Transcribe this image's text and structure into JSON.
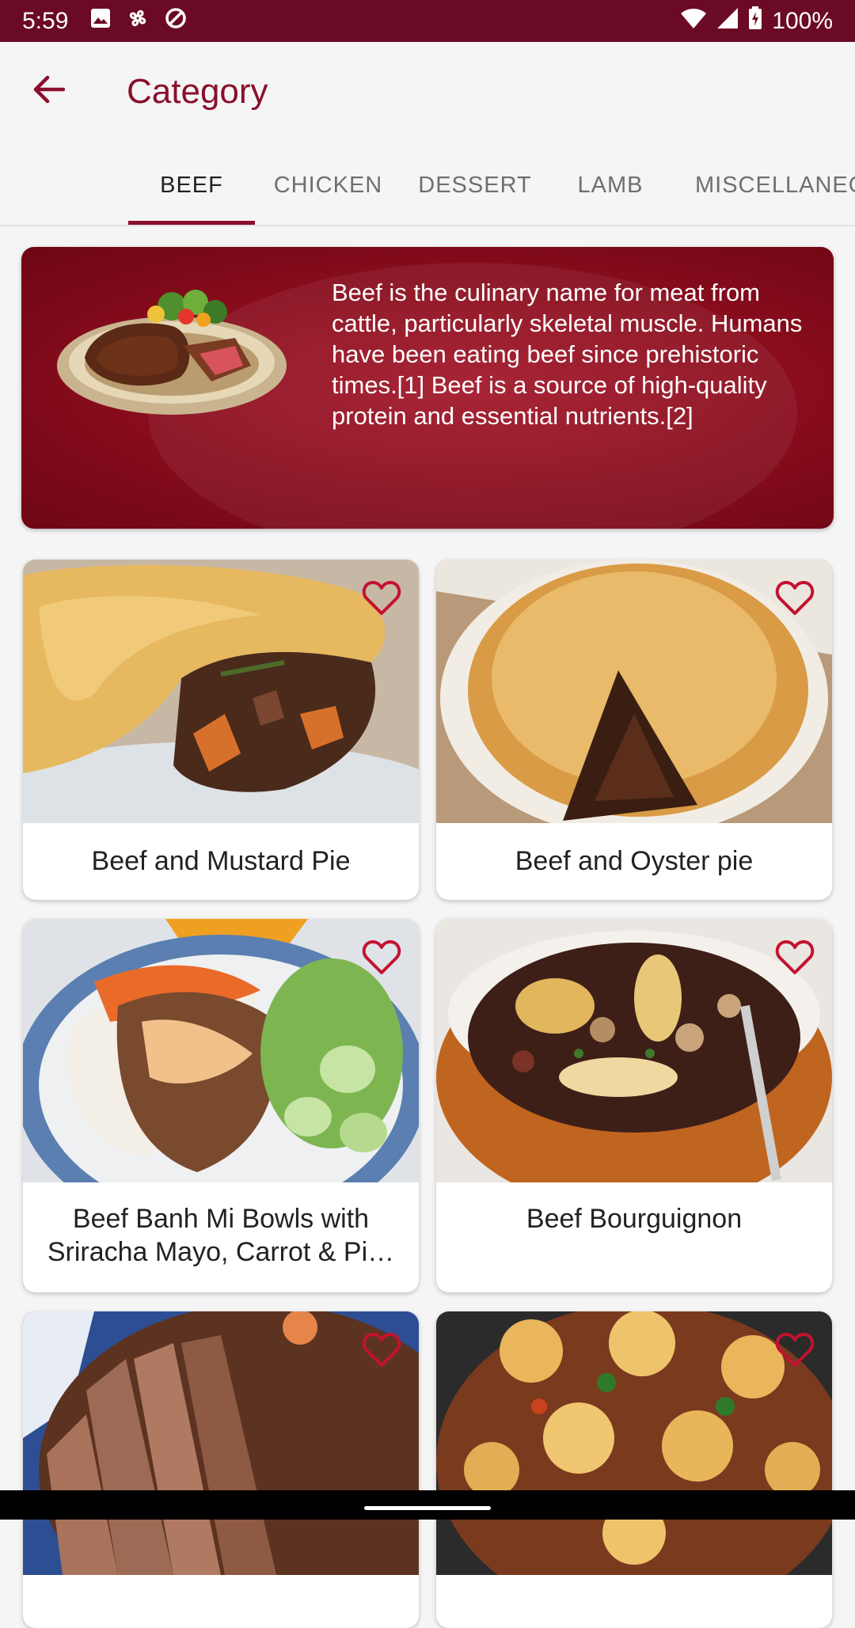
{
  "status_bar": {
    "time": "5:59",
    "battery": "100%",
    "icons": [
      "image-icon",
      "pinwheel-icon",
      "no-sign-icon",
      "wifi-icon",
      "signal-icon",
      "battery-icon"
    ]
  },
  "app_bar": {
    "title": "Category",
    "back_icon": "arrow-back-icon"
  },
  "tabs": [
    {
      "label": "BEEF",
      "active": true
    },
    {
      "label": "CHICKEN",
      "active": false
    },
    {
      "label": "DESSERT",
      "active": false
    },
    {
      "label": "LAMB",
      "active": false
    },
    {
      "label": "MISCELLANEOUS",
      "active": false
    }
  ],
  "category_banner": {
    "description": "Beef is the culinary name for meat from cattle, particularly skeletal muscle. Humans have been eating beef since prehistoric times.[1] Beef is a source of high-quality protein and essential nutrients.[2]"
  },
  "recipes": [
    {
      "name": "Beef and Mustard Pie",
      "favorite": false
    },
    {
      "name": "Beef and Oyster pie",
      "favorite": false
    },
    {
      "name": "Beef Banh Mi Bowls with Sriracha Mayo, Carrot & Pi…",
      "favorite": false
    },
    {
      "name": "Beef Bourguignon",
      "favorite": false
    },
    {
      "name": "",
      "favorite": false
    },
    {
      "name": "",
      "favorite": false
    }
  ],
  "colors": {
    "status_bar": "#6b0a24",
    "accent": "#8a0f2c",
    "banner": "#8d0e1e",
    "background": "#f5f5f5"
  }
}
